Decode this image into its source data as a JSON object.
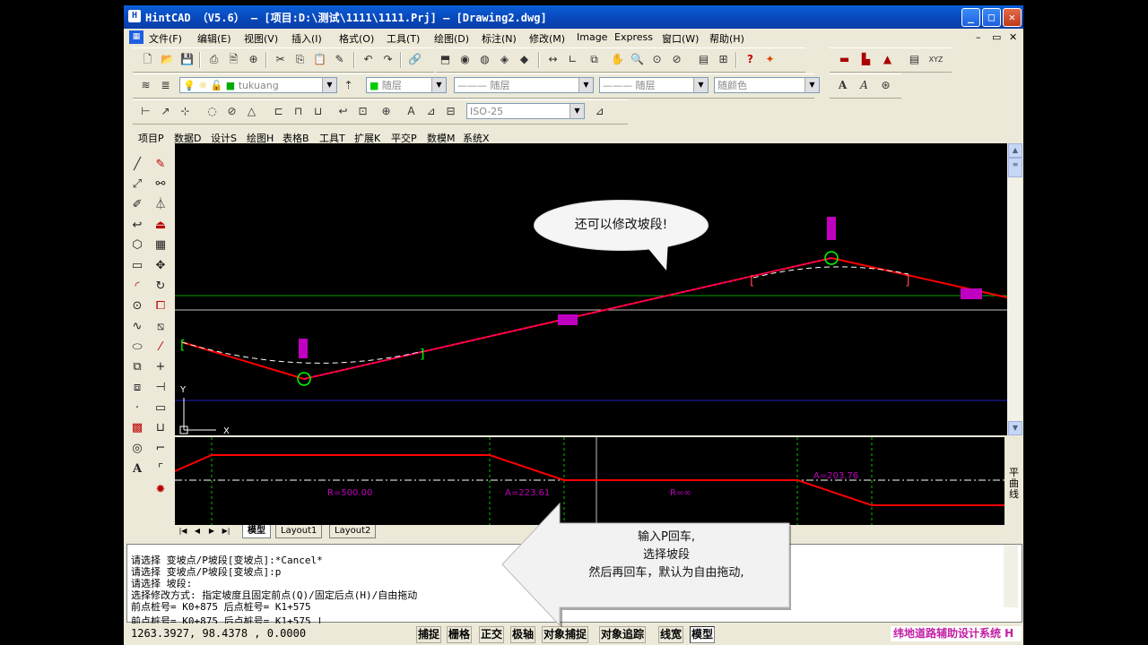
{
  "window": {
    "title": "HintCAD （V5.6） – [项目:D:\\测试\\1111\\1111.Prj] – [Drawing2.dwg]",
    "minimize": "_",
    "maximize": "□",
    "close": "✕"
  },
  "menu": [
    "文件(F)",
    "编辑(E)",
    "视图(V)",
    "插入(I)",
    "格式(O)",
    "工具(T)",
    "绘图(D)",
    "标注(N)",
    "修改(M)",
    "Image",
    "Express",
    "窗口(W)",
    "帮助(H)"
  ],
  "mdi_controls": [
    "–",
    "▭",
    "✕"
  ],
  "layer_toolbar": {
    "layer_name": "tukuang",
    "color": "随层",
    "linetype": "——— 随层",
    "lineweight": "——— 随层",
    "plotstyle": "随颜色"
  },
  "dim_toolbar": {
    "dimstyle": "ISO-25"
  },
  "custom_menu": [
    "项目P",
    "数据D",
    "设计S",
    "绘图H",
    "表格B",
    "工具T",
    "扩展K",
    "平交P",
    "数模M",
    "系统X"
  ],
  "tabs": [
    "模型",
    "Layout1",
    "Layout2"
  ],
  "ucs": {
    "y": "Y",
    "x": "X"
  },
  "profile": {
    "label_side": "平曲线",
    "labels": [
      "R=500.00",
      "A=223.61",
      "R=∞",
      "A=203.76"
    ]
  },
  "bubble_text": "还可以修改坡段!",
  "callout_lines": [
    "输入P回车,",
    "选择坡段",
    "然后再回车，默认为自由拖动,"
  ],
  "command_lines": [
    "请选择 变坡点/P坡段[变坡点]:*Cancel*",
    "请选择 变坡点/P坡段[变坡点]:p",
    "请选择 坡段:",
    "选择修改方式: 指定坡度且固定前点(Q)/固定后点(H)/自由拖动",
    "前点桩号= K0+875 后点桩号= K1+575",
    "前点桩号= K0+875 后点桩号= K1+575 |"
  ],
  "status": {
    "coords": "1263.3927, 98.4378 , 0.0000",
    "buttons": [
      "捕捉",
      "栅格",
      "正交",
      "极轴",
      "对象捕捉",
      "对象追踪",
      "线宽",
      "模型"
    ],
    "brand": "纬地道路辅助设计系统 H"
  },
  "colors": {
    "background": "#000000",
    "grade_line": "#ff0000",
    "curve": "#00ff00",
    "highlight": "#ff00ff",
    "xp_blue": "#0a5fd8"
  }
}
